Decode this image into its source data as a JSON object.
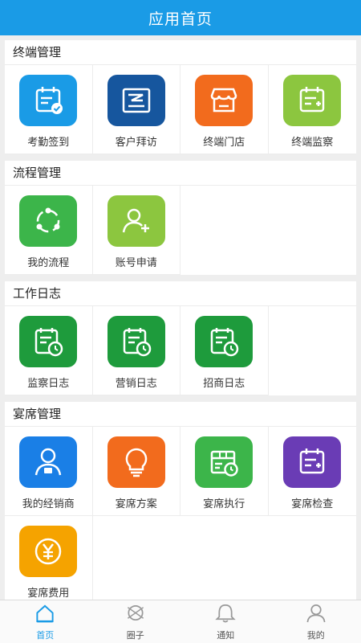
{
  "header": {
    "title": "应用首页"
  },
  "sections": [
    {
      "title": "终端管理",
      "items": [
        {
          "label": "考勤签到",
          "icon": "calendar-check-icon",
          "color": "#1a9be6"
        },
        {
          "label": "客户拜访",
          "icon": "shop-sign-icon",
          "color": "#16569e"
        },
        {
          "label": "终端门店",
          "icon": "store-icon",
          "color": "#f26b1d"
        },
        {
          "label": "终端监察",
          "icon": "calendar-plus-icon",
          "color": "#8cc63f"
        }
      ]
    },
    {
      "title": "流程管理",
      "items": [
        {
          "label": "我的流程",
          "icon": "share-flow-icon",
          "color": "#3cb54a"
        },
        {
          "label": "账号申请",
          "icon": "user-add-icon",
          "color": "#8cc63f"
        }
      ]
    },
    {
      "title": "工作日志",
      "items": [
        {
          "label": "监察日志",
          "icon": "log-clock-icon",
          "color": "#1e9b3c"
        },
        {
          "label": "营销日志",
          "icon": "log-clock-icon",
          "color": "#1e9b3c"
        },
        {
          "label": "招商日志",
          "icon": "log-clock-icon",
          "color": "#1e9b3c"
        }
      ]
    },
    {
      "title": "宴席管理",
      "items": [
        {
          "label": "我的经销商",
          "icon": "dealer-user-icon",
          "color": "#1a7fe6"
        },
        {
          "label": "宴席方案",
          "icon": "lightbulb-icon",
          "color": "#f26b1d"
        },
        {
          "label": "宴席执行",
          "icon": "box-clock-icon",
          "color": "#3cb54a"
        },
        {
          "label": "宴席检查",
          "icon": "calendar-plus-icon",
          "color": "#6a3cb5"
        },
        {
          "label": "宴席费用",
          "icon": "yuan-coin-icon",
          "color": "#f5a300"
        }
      ]
    }
  ],
  "tabs": [
    {
      "label": "首页",
      "icon": "home-icon",
      "active": true
    },
    {
      "label": "圈子",
      "icon": "circle-compass-icon",
      "active": false
    },
    {
      "label": "通知",
      "icon": "bell-icon",
      "active": false
    },
    {
      "label": "我的",
      "icon": "user-icon",
      "active": false
    }
  ],
  "colors": {
    "accent": "#1a9be6",
    "tab_inactive": "#999999"
  }
}
